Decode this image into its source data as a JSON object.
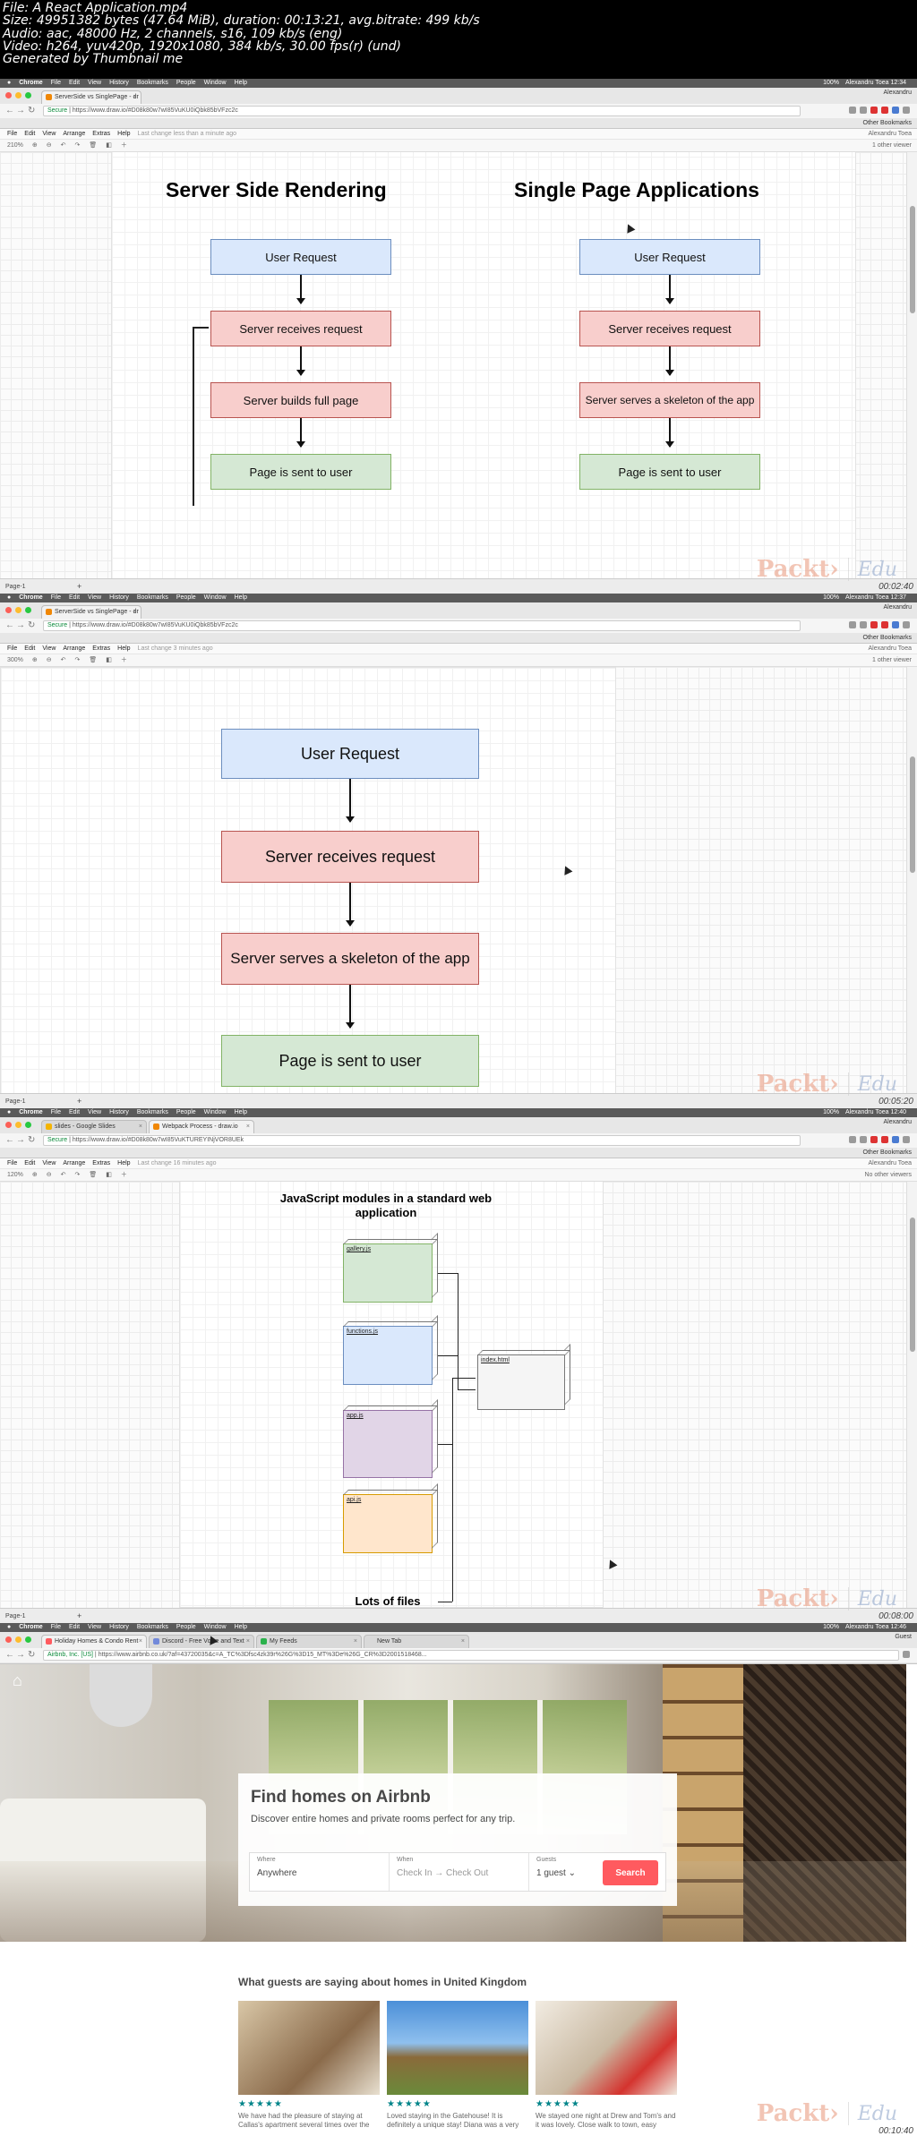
{
  "header": {
    "lines": [
      "File: A React Application.mp4",
      "Size: 49951382 bytes (47.64 MiB), duration: 00:13:21, avg.bitrate: 499 kb/s",
      "Audio: aac, 48000 Hz, 2 channels, s16, 109 kb/s (eng)",
      "Video: h264, yuv420p, 1920x1080, 384 kb/s, 30.00 fps(r) (und)",
      "Generated by Thumbnail me"
    ]
  },
  "mac_menu": [
    "Chrome",
    "File",
    "Edit",
    "View",
    "History",
    "Bookmarks",
    "People",
    "Window",
    "Help"
  ],
  "watermark": {
    "brand1": "Packt›",
    "brand2": "Edu"
  },
  "frames": [
    {
      "clock": "Alexandru Toea  12:34",
      "battery": "100%",
      "profile": "Alexandru",
      "tabs": [
        {
          "label": "ServerSide vs SinglePage - dr"
        }
      ],
      "url_secure": "Secure",
      "url": "https://www.draw.io/#D08k80w7wI85VuKU0iQbk85bVFzc2c",
      "bookmarks": "Other Bookmarks",
      "app_menu": [
        "File",
        "Edit",
        "View",
        "Arrange",
        "Extras",
        "Help"
      ],
      "last_change": "Last change less than a minute ago",
      "right_user": "Alexandru Toea",
      "zoom": "210%",
      "collab": "1 other viewer",
      "page_tab": "Page-1",
      "timecode": "00:02:40",
      "diagram": {
        "left_title": "Server Side Rendering",
        "right_title": "Single Page Applications",
        "left_boxes": [
          "User Request",
          "Server receives request",
          "Server builds full page",
          "Page is sent to user"
        ],
        "right_boxes": [
          "User Request",
          "Server receives request",
          "Server serves a skeleton of the app",
          "Page is sent to user"
        ]
      }
    },
    {
      "clock": "Alexandru Toea  12:37",
      "battery": "100%",
      "profile": "Alexandru",
      "tabs": [
        {
          "label": "ServerSide vs SinglePage - dr"
        }
      ],
      "url_secure": "Secure",
      "url": "https://www.draw.io/#D08k80w7wI85VuKU0iQbk85bVFzc2c",
      "bookmarks": "Other Bookmarks",
      "app_menu": [
        "File",
        "Edit",
        "View",
        "Arrange",
        "Extras",
        "Help"
      ],
      "last_change": "Last change 3 minutes ago",
      "right_user": "Alexandru Toea",
      "zoom": "300%",
      "collab": "1 other viewer",
      "page_tab": "Page-1",
      "timecode": "00:05:20",
      "diagram": {
        "boxes": [
          "User Request",
          "Server receives request",
          "Server serves a skeleton of the app",
          "Page is sent to user"
        ]
      }
    },
    {
      "clock": "Alexandru Toea  12:40",
      "battery": "100%",
      "profile": "Alexandru",
      "tabs": [
        {
          "label": "slides - Google Slides"
        },
        {
          "label": "Webpack Process - draw.io"
        }
      ],
      "url_secure": "Secure",
      "url": "https://www.draw.io/#D08k80w7wI85VuKTUREYINjVOR8UEk",
      "bookmarks": "Other Bookmarks",
      "app_menu": [
        "File",
        "Edit",
        "View",
        "Arrange",
        "Extras",
        "Help"
      ],
      "last_change": "Last change 16 minutes ago",
      "right_user": "Alexandru Toea",
      "zoom": "120%",
      "collab": "No other viewers",
      "page_tab": "Page-1",
      "timecode": "00:08:00",
      "diagram": {
        "title": "JavaScript modules in a standard web application",
        "modules": [
          "gallery.js",
          "functions.js",
          "app.js",
          "api.js"
        ],
        "target": "index.html",
        "footer": "Lots of files"
      }
    },
    {
      "clock": "Alexandru Toea  12:46",
      "battery": "100%",
      "profile": "Guest",
      "tabs": [
        {
          "label": "Holiday Homes & Condo Rent"
        },
        {
          "label": "Discord - Free Voice and Text"
        },
        {
          "label": "My Feeds"
        },
        {
          "label": "New Tab"
        }
      ],
      "url_secure": "Airbnb, Inc. [US]",
      "url": "https://www.airbnb.co.uk/?af=43720035&c=A_TC%3Dfsc4zk39r%26G%3D15_MT%3De%26G_CR%3D2001518468...",
      "timecode": "00:10:40",
      "airbnb": {
        "heading": "Find homes on Airbnb",
        "subheading": "Discover entire homes and private rooms perfect for any trip.",
        "where_label": "Where",
        "where_value": "Anywhere",
        "when_label": "When",
        "when_value": "Check In  →  Check Out",
        "guests_label": "Guests",
        "guests_value": "1 guest",
        "search_button": "Search",
        "reviews_heading": "What guests are saying about homes in United Kingdom",
        "reviews": [
          {
            "stars": "★★★★★",
            "text": "We have had the pleasure of staying at Callas's apartment several times over the"
          },
          {
            "stars": "★★★★★",
            "text": "Loved staying in the Gatehouse! It is definitely a unique stay! Diana was a very"
          },
          {
            "stars": "★★★★★",
            "text": "We stayed one night at Drew and Tom's and it was lovely. Close walk to town, easy"
          }
        ]
      }
    }
  ]
}
